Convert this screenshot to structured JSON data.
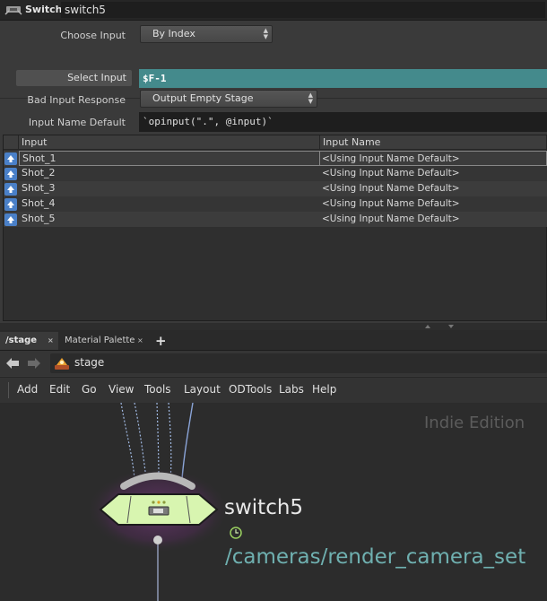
{
  "header": {
    "node_type": "Switch",
    "node_name": "switch5"
  },
  "params": {
    "choose_input": {
      "label": "Choose Input",
      "value": "By Index"
    },
    "select_input": {
      "label": "Select Input",
      "value": "$F-1"
    },
    "bad_input_response": {
      "label": "Bad Input Response",
      "value": "Output Empty Stage"
    },
    "input_name_default": {
      "label": "Input Name Default",
      "value": "`opinput(\".\", @input)`"
    }
  },
  "table": {
    "headers": [
      "Input",
      "Input Name"
    ],
    "rows": [
      {
        "input": "Shot_1",
        "name": "<Using Input Name Default>"
      },
      {
        "input": "Shot_2",
        "name": "<Using Input Name Default>"
      },
      {
        "input": "Shot_3",
        "name": "<Using Input Name Default>"
      },
      {
        "input": "Shot_4",
        "name": "<Using Input Name Default>"
      },
      {
        "input": "Shot_5",
        "name": "<Using Input Name Default>"
      }
    ]
  },
  "tabs": [
    {
      "label": "/stage",
      "close": "×"
    },
    {
      "label": "Material Palette",
      "close": "×"
    }
  ],
  "add_tab": "+",
  "path": {
    "label": "stage"
  },
  "menu": [
    "Add",
    "Edit",
    "Go",
    "View",
    "Tools",
    "Layout",
    "ODTools",
    "Labs",
    "Help"
  ],
  "network": {
    "watermark": "Indie Edition",
    "node_name": "switch5",
    "node_comment": "/cameras/render_camera_set"
  },
  "colors": {
    "select_input_bg": "#448a8c",
    "node_body": "#d8f5b0",
    "node_glow": "#6b3a70",
    "comment_text": "#6fb0b0"
  }
}
